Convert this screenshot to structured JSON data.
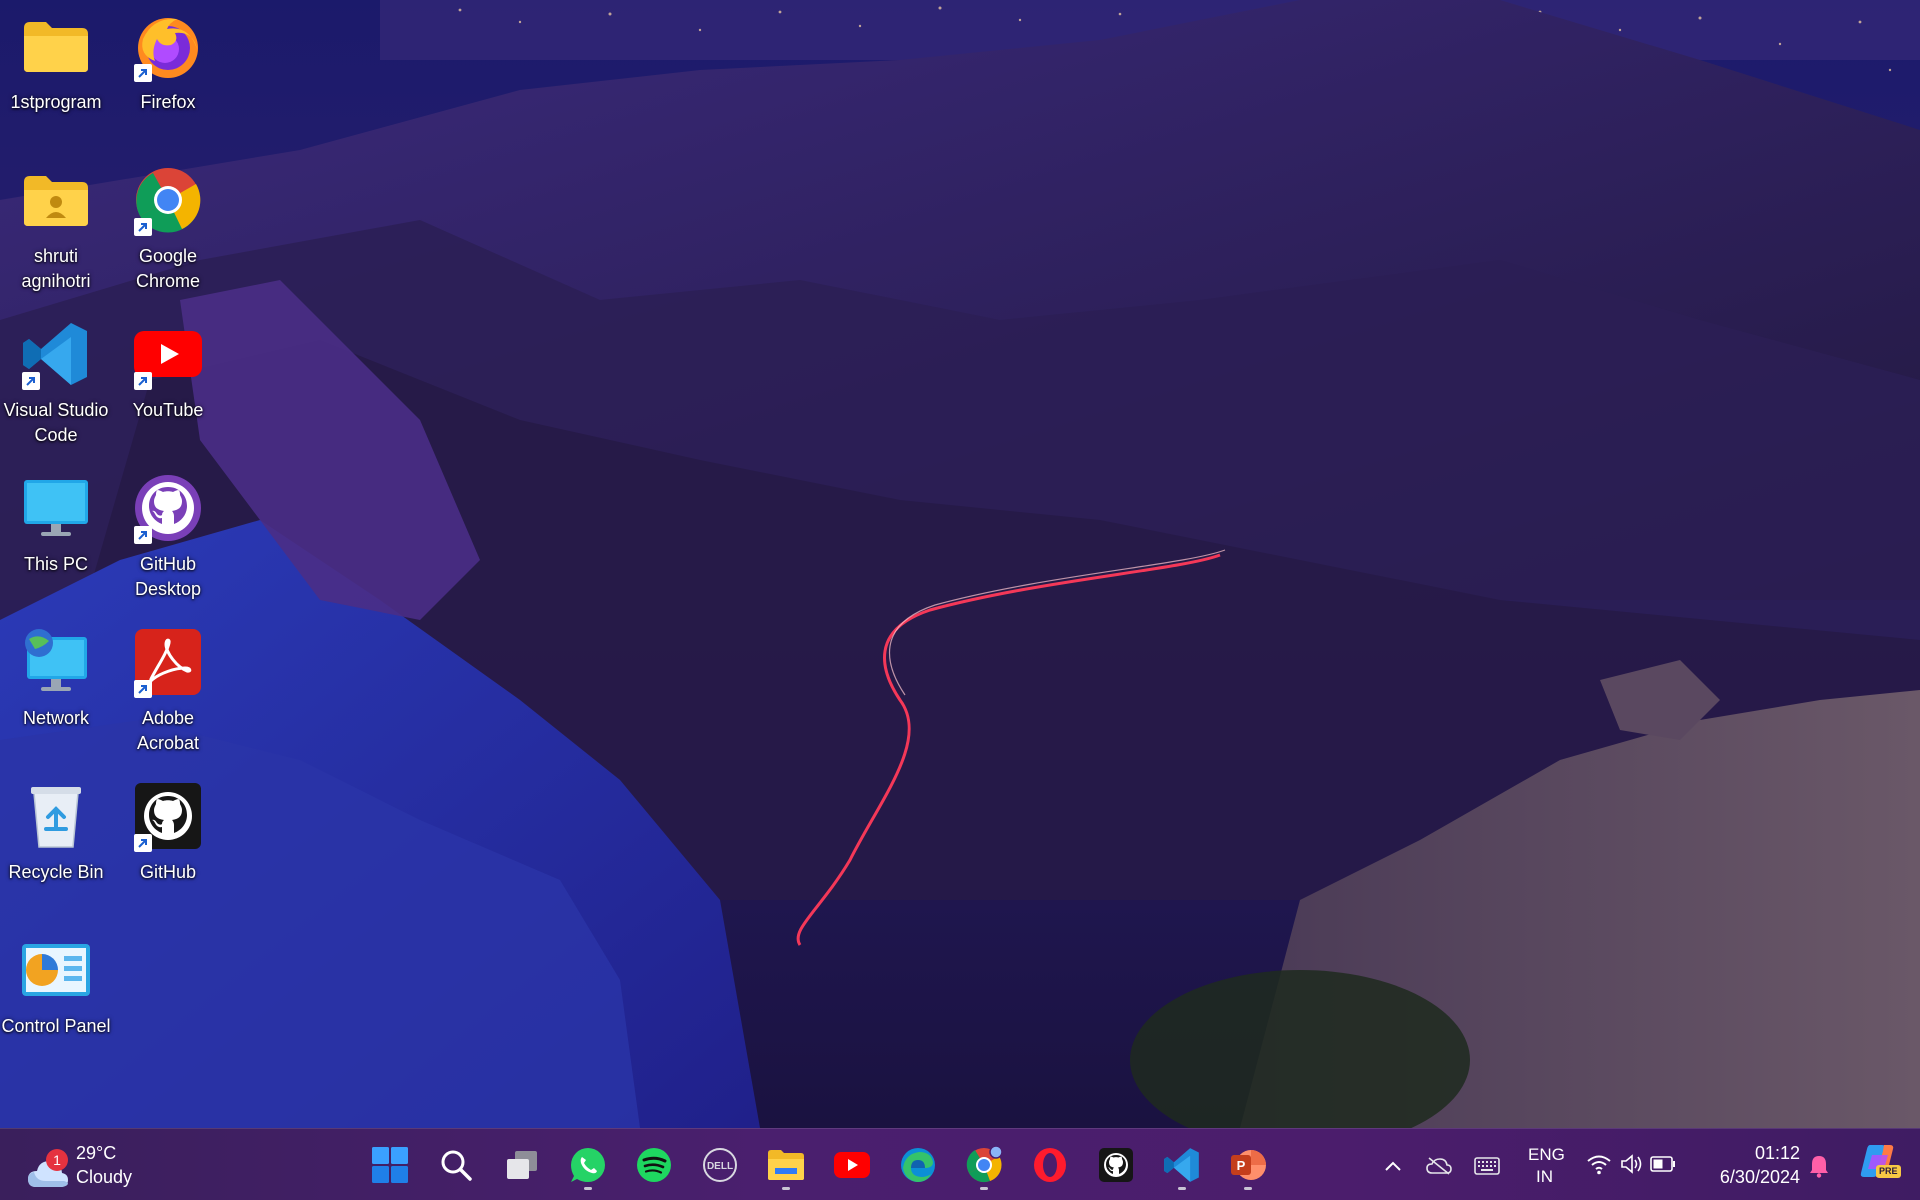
{
  "desktop": {
    "icons": [
      {
        "label": "1stprogram"
      },
      {
        "label": "Firefox"
      },
      {
        "label": "shruti agnihotri"
      },
      {
        "label": "Google Chrome"
      },
      {
        "label": "Visual Studio Code"
      },
      {
        "label": "YouTube"
      },
      {
        "label": "This PC"
      },
      {
        "label": "GitHub Desktop"
      },
      {
        "label": "Network"
      },
      {
        "label": "Adobe Acrobat"
      },
      {
        "label": "Recycle Bin"
      },
      {
        "label": "GitHub"
      },
      {
        "label": "Control Panel"
      }
    ]
  },
  "taskbar": {
    "weather": {
      "temp": "29°C",
      "condition": "Cloudy",
      "badge": "1"
    },
    "apps": [
      {
        "name": "start-icon"
      },
      {
        "name": "search-icon"
      },
      {
        "name": "task-view-icon"
      },
      {
        "name": "whatsapp-icon"
      },
      {
        "name": "spotify-icon"
      },
      {
        "name": "dell-icon"
      },
      {
        "name": "file-explorer-icon"
      },
      {
        "name": "youtube-icon"
      },
      {
        "name": "edge-icon"
      },
      {
        "name": "chrome-icon"
      },
      {
        "name": "opera-icon"
      },
      {
        "name": "github-icon"
      },
      {
        "name": "vscode-icon"
      },
      {
        "name": "powerpoint-icon"
      }
    ],
    "tray": {
      "lang_top": "ENG",
      "lang_bottom": "IN",
      "time": "01:12",
      "date": "6/30/2024",
      "copilot_badge": "PRE"
    }
  },
  "colors": {
    "taskbar": "#47206a",
    "accent": "#2f7bf5"
  }
}
